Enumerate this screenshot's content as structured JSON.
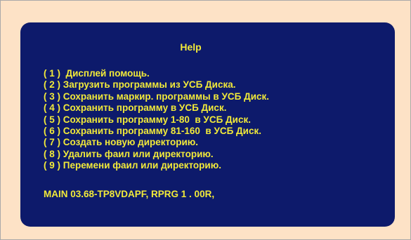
{
  "help": {
    "title": "Help",
    "items": [
      {
        "label": "( 1 )  Дисплей помощь."
      },
      {
        "label": "( 2 ) Загрузить программы из УСБ Диска."
      },
      {
        "label": "( 3 ) Сохранить маркир. программы в УСБ Диск."
      },
      {
        "label": "( 4 ) Сохранить программу в УСБ Диск."
      },
      {
        "label": "( 5 ) Сохранить программу 1-80  в УСБ Диск."
      },
      {
        "label": "( 6 ) Сохранить программу 81-160  в УСБ Диск."
      },
      {
        "label": "( 7 ) Создать новую директорию."
      },
      {
        "label": "( 8 ) Удалить фаил или директорию."
      },
      {
        "label": "( 9 ) Перемени фаил или директорию."
      }
    ],
    "status": "MAIN 03.68-TP8VDAPF, RPRG 1 . 00R,"
  },
  "colors": {
    "page_background": "#fde2c6",
    "panel_background": "#0d1a6b",
    "text": "#f2ea39"
  }
}
